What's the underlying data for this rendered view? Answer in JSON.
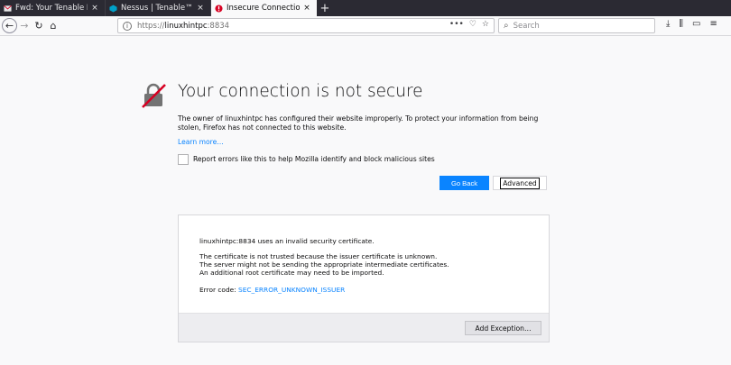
{
  "tabs": [
    {
      "label": "Fwd: Your Tenable Nessus",
      "icon": "mail-icon",
      "close": "×"
    },
    {
      "label": "Nessus | Tenable™",
      "icon": "nessus-icon",
      "close": "×"
    },
    {
      "label": "Insecure Connection",
      "icon": "warning-icon",
      "close": "×"
    }
  ],
  "new_tab": "+",
  "url": {
    "protocol": "https://",
    "host": "linuxhintpc",
    "port": ":8834"
  },
  "search": {
    "placeholder": "Search"
  },
  "page": {
    "title": "Your connection is not secure",
    "description": "The owner of linuxhintpc has configured their website improperly. To protect your information from being stolen, Firefox has not connected to this website.",
    "learn_more": "Learn more…",
    "report_label": "Report errors like this to help Mozilla identify and block malicious sites",
    "go_back": "Go Back",
    "advanced": "Advanced"
  },
  "details": {
    "line1": "linuxhintpc:8834 uses an invalid security certificate.",
    "line2": "The certificate is not trusted because the issuer certificate is unknown.",
    "line3": "The server might not be sending the appropriate intermediate certificates.",
    "line4": "An additional root certificate may need to be imported.",
    "error_prefix": "Error code: ",
    "error_code": "SEC_ERROR_UNKNOWN_ISSUER",
    "add_exception": "Add Exception…"
  },
  "colors": {
    "accent": "#0a84ff",
    "tabbar": "#2b2a33",
    "error_icon": "#d70022"
  }
}
